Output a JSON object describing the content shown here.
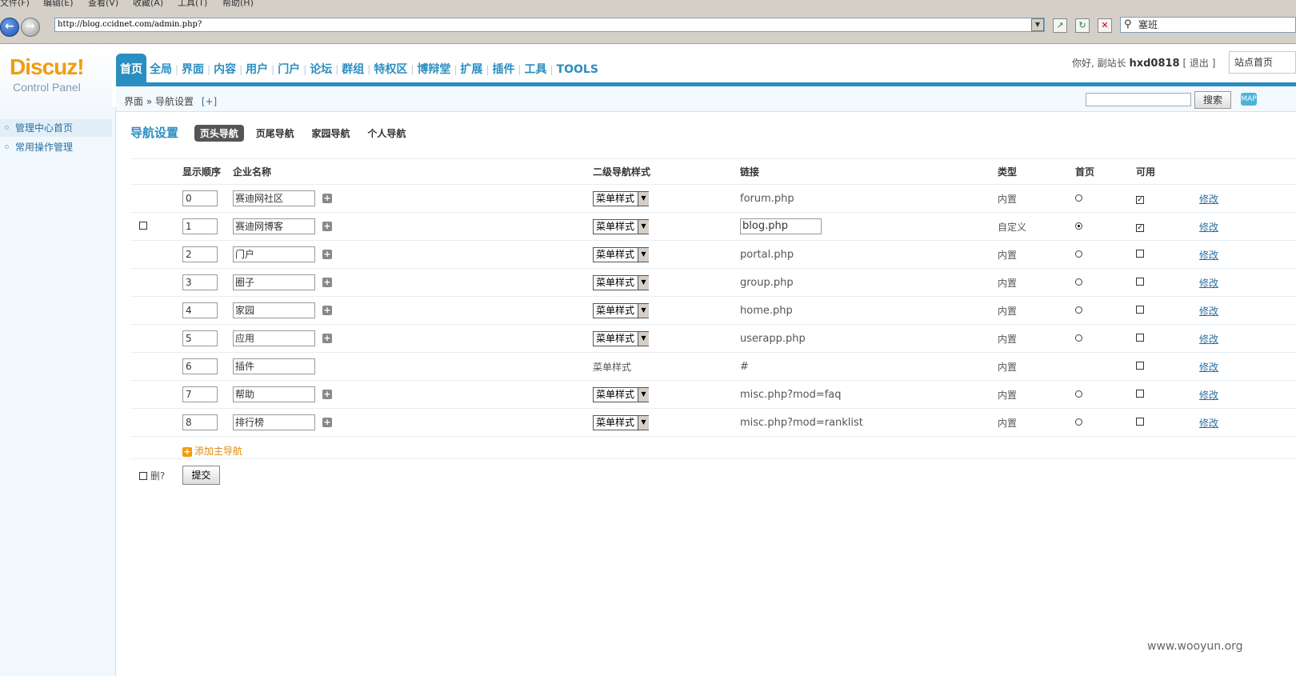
{
  "browser": {
    "menu": [
      "文件(F)",
      "编辑(E)",
      "查看(V)",
      "收藏(A)",
      "工具(T)",
      "帮助(H)"
    ],
    "url": "http://blog.ccidnet.com/admin.php?",
    "search_text": "塞班"
  },
  "logo": {
    "brand": "Discuz!",
    "sub": "Control Panel"
  },
  "topnav": [
    "首页",
    "全局",
    "界面",
    "内容",
    "用户",
    "门户",
    "论坛",
    "群组",
    "特权区",
    "博辩堂",
    "扩展",
    "插件",
    "工具",
    "TOOLS"
  ],
  "welcome": {
    "greeting": "你好, 副站长",
    "user": "hxd0818",
    "logout": "[ 退出 ]",
    "site": "站点首页"
  },
  "breadcrumb": {
    "path": "界面 » 导航设置",
    "add": "[+]"
  },
  "header_search": {
    "button": "搜索",
    "map": "MAP"
  },
  "sidebar": [
    "管理中心首页",
    "常用操作管理"
  ],
  "tabs": {
    "title": "导航设置",
    "items": [
      "页头导航",
      "页尾导航",
      "家园导航",
      "个人导航"
    ]
  },
  "table": {
    "headers": [
      "显示顺序",
      "企业名称",
      "二级导航样式",
      "链接",
      "类型",
      "首页",
      "可用"
    ],
    "rows": [
      {
        "order": "0",
        "name": "赛迪网社区",
        "style": "菜单样式",
        "link": "forum.php",
        "type": "内置",
        "edit": "修改"
      },
      {
        "order": "1",
        "name": "赛迪网博客",
        "style": "菜单样式",
        "link": "blog.php",
        "type": "自定义",
        "edit": "修改"
      },
      {
        "order": "2",
        "name": "门户",
        "style": "菜单样式",
        "link": "portal.php",
        "type": "内置",
        "edit": "修改"
      },
      {
        "order": "3",
        "name": "圈子",
        "style": "菜单样式",
        "link": "group.php",
        "type": "内置",
        "edit": "修改"
      },
      {
        "order": "4",
        "name": "家园",
        "style": "菜单样式",
        "link": "home.php",
        "type": "内置",
        "edit": "修改"
      },
      {
        "order": "5",
        "name": "应用",
        "style": "菜单样式",
        "link": "userapp.php",
        "type": "内置",
        "edit": "修改"
      },
      {
        "order": "6",
        "name": "插件",
        "style": "菜单样式",
        "link": "#",
        "type": "内置",
        "edit": "修改"
      },
      {
        "order": "7",
        "name": "帮助",
        "style": "菜单样式",
        "link": "misc.php?mod=faq",
        "type": "内置",
        "edit": "修改"
      },
      {
        "order": "8",
        "name": "排行榜",
        "style": "菜单样式",
        "link": "misc.php?mod=ranklist",
        "type": "内置",
        "edit": "修改"
      }
    ],
    "add_label": "添加主导航"
  },
  "footer": {
    "delete_label": "删?",
    "submit": "提交"
  },
  "watermark": "www.wooyun.org"
}
